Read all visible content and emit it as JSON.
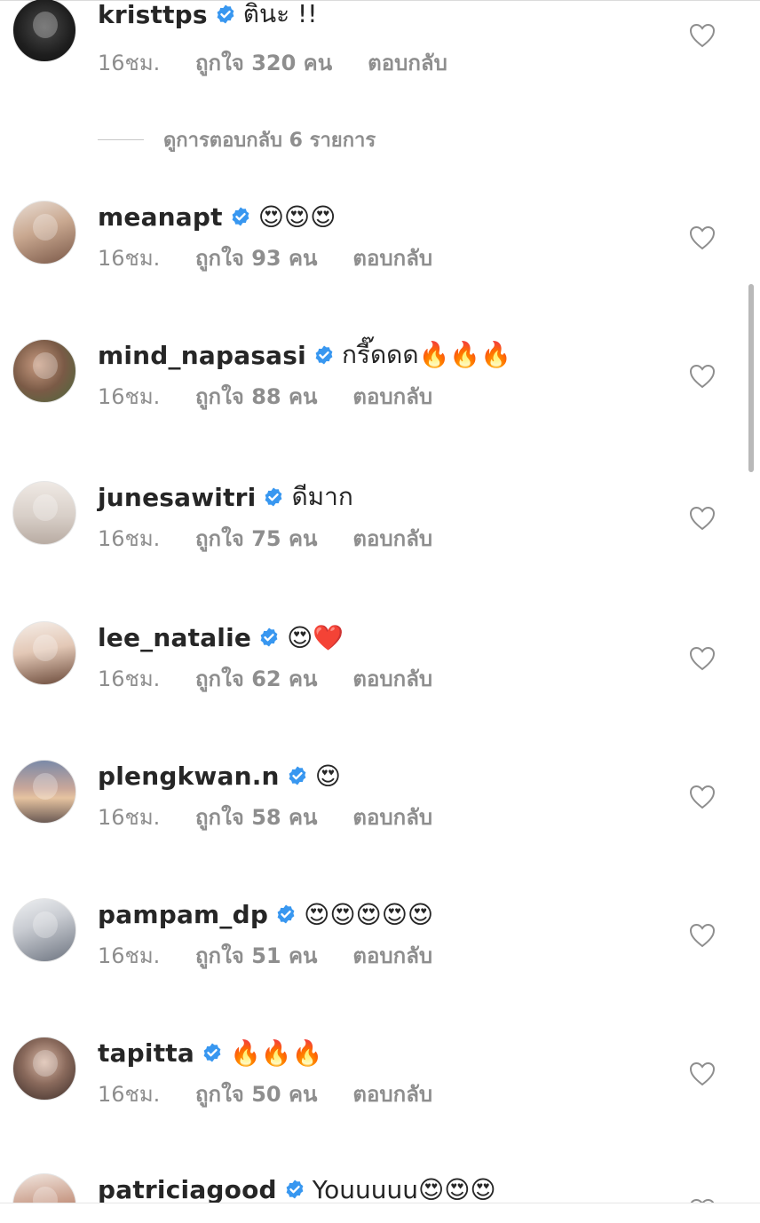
{
  "view_replies": "ดูการตอบกลับ 6 รายการ",
  "comments": [
    {
      "username": "kristtps",
      "text": "ตินะ !!",
      "time": "16ชม.",
      "likes": "ถูกใจ 320 คน",
      "reply": "ตอบกลับ"
    },
    {
      "username": "meanapt",
      "text": "😍😍😍",
      "time": "16ชม.",
      "likes": "ถูกใจ 93 คน",
      "reply": "ตอบกลับ"
    },
    {
      "username": "mind_napasasi",
      "text": "กรี๊ดดด🔥🔥🔥",
      "time": "16ชม.",
      "likes": "ถูกใจ 88 คน",
      "reply": "ตอบกลับ"
    },
    {
      "username": "junesawitri",
      "text": "ดีมาก",
      "time": "16ชม.",
      "likes": "ถูกใจ 75 คน",
      "reply": "ตอบกลับ"
    },
    {
      "username": "lee_natalie",
      "text": "😍❤️",
      "time": "16ชม.",
      "likes": "ถูกใจ 62 คน",
      "reply": "ตอบกลับ"
    },
    {
      "username": "plengkwan.n",
      "text": "😍",
      "time": "16ชม.",
      "likes": "ถูกใจ 58 คน",
      "reply": "ตอบกลับ"
    },
    {
      "username": "pampam_dp",
      "text": "😍😍😍😍😍",
      "time": "16ชม.",
      "likes": "ถูกใจ 51 คน",
      "reply": "ตอบกลับ"
    },
    {
      "username": "tapitta",
      "text": "🔥🔥🔥",
      "time": "16ชม.",
      "likes": "ถูกใจ 50 คน",
      "reply": "ตอบกลับ"
    },
    {
      "username": "patriciagood",
      "text": "Youuuuu😍😍😍",
      "time": "",
      "likes": "",
      "reply": ""
    }
  ],
  "colors": {
    "verified": "#3897f0",
    "meta_text": "#8e8e8e",
    "primary_text": "#262626"
  }
}
